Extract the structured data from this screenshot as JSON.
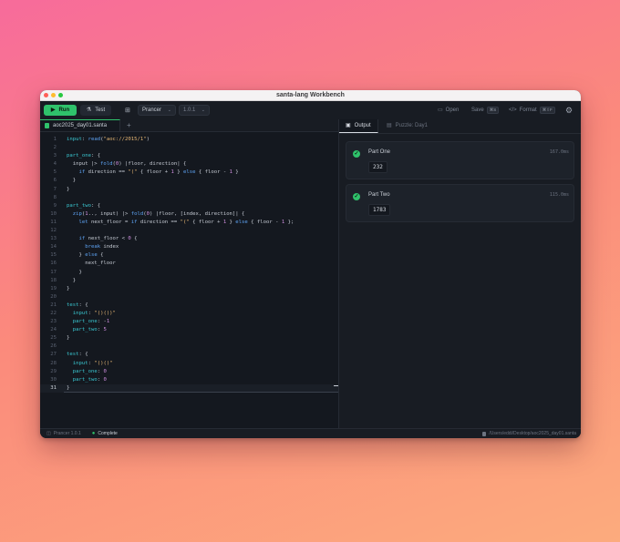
{
  "window": {
    "title": "santa-lang Workbench"
  },
  "toolbar": {
    "run_label": "Run",
    "test_label": "Test",
    "runtime_select": "Prancer",
    "version_select": "1.0.1",
    "open_label": "Open",
    "save_label": "Save",
    "save_shortcut": "⌘S",
    "format_label": "Format",
    "format_shortcut": "⌘⇧F"
  },
  "editor": {
    "tab_name": "aoc2025_day01.santa",
    "tab_add": "+",
    "lines": [
      {
        "n": "1",
        "code": "input: read(\"aoc://2015/1\")"
      },
      {
        "n": "2",
        "code": ""
      },
      {
        "n": "3",
        "code": "part_one: {"
      },
      {
        "n": "4",
        "code": "  input |> fold(0) |floor, direction| {"
      },
      {
        "n": "5",
        "code": "    if direction == \"(\" { floor + 1 } else { floor - 1 }"
      },
      {
        "n": "6",
        "code": "  }"
      },
      {
        "n": "7",
        "code": "}"
      },
      {
        "n": "8",
        "code": ""
      },
      {
        "n": "9",
        "code": "part_two: {"
      },
      {
        "n": "10",
        "code": "  zip(1.., input) |> fold(0) |floor, [index, direction]| {"
      },
      {
        "n": "11",
        "code": "    let next_floor = if direction == \"(\" { floor + 1 } else { floor - 1 };"
      },
      {
        "n": "12",
        "code": ""
      },
      {
        "n": "13",
        "code": "    if next_floor < 0 {"
      },
      {
        "n": "14",
        "code": "      break index"
      },
      {
        "n": "15",
        "code": "    } else {"
      },
      {
        "n": "16",
        "code": "      next_floor"
      },
      {
        "n": "17",
        "code": "    }"
      },
      {
        "n": "18",
        "code": "  }"
      },
      {
        "n": "19",
        "code": "}"
      },
      {
        "n": "20",
        "code": ""
      },
      {
        "n": "21",
        "code": "test: {"
      },
      {
        "n": "22",
        "code": "  input: \"()())\""
      },
      {
        "n": "23",
        "code": "  part_one: -1"
      },
      {
        "n": "24",
        "code": "  part_two: 5"
      },
      {
        "n": "25",
        "code": "}"
      },
      {
        "n": "26",
        "code": ""
      },
      {
        "n": "27",
        "code": "test: {"
      },
      {
        "n": "28",
        "code": "  input: \"()()\""
      },
      {
        "n": "29",
        "code": "  part_one: 0"
      },
      {
        "n": "30",
        "code": "  part_two: 0"
      },
      {
        "n": "31",
        "code": "}"
      }
    ]
  },
  "output": {
    "tab_output": "Output",
    "tab_puzzle": "Puzzle: Day1",
    "results": [
      {
        "title": "Part One",
        "time": "167.0ms",
        "value": "232"
      },
      {
        "title": "Part Two",
        "time": "115.0ms",
        "value": "1783"
      }
    ]
  },
  "statusbar": {
    "runtime": "Prancer 1.0.1",
    "status": "Complete",
    "file_path": "/Users/eddi/Desktop/aoc2025_day01.santa"
  },
  "colors": {
    "accent": "#2fc26b",
    "keyword": "#5ea4f5",
    "string": "#e6b673",
    "number": "#d08fe0",
    "identifier": "#39c5cf",
    "background": "#14181f"
  }
}
